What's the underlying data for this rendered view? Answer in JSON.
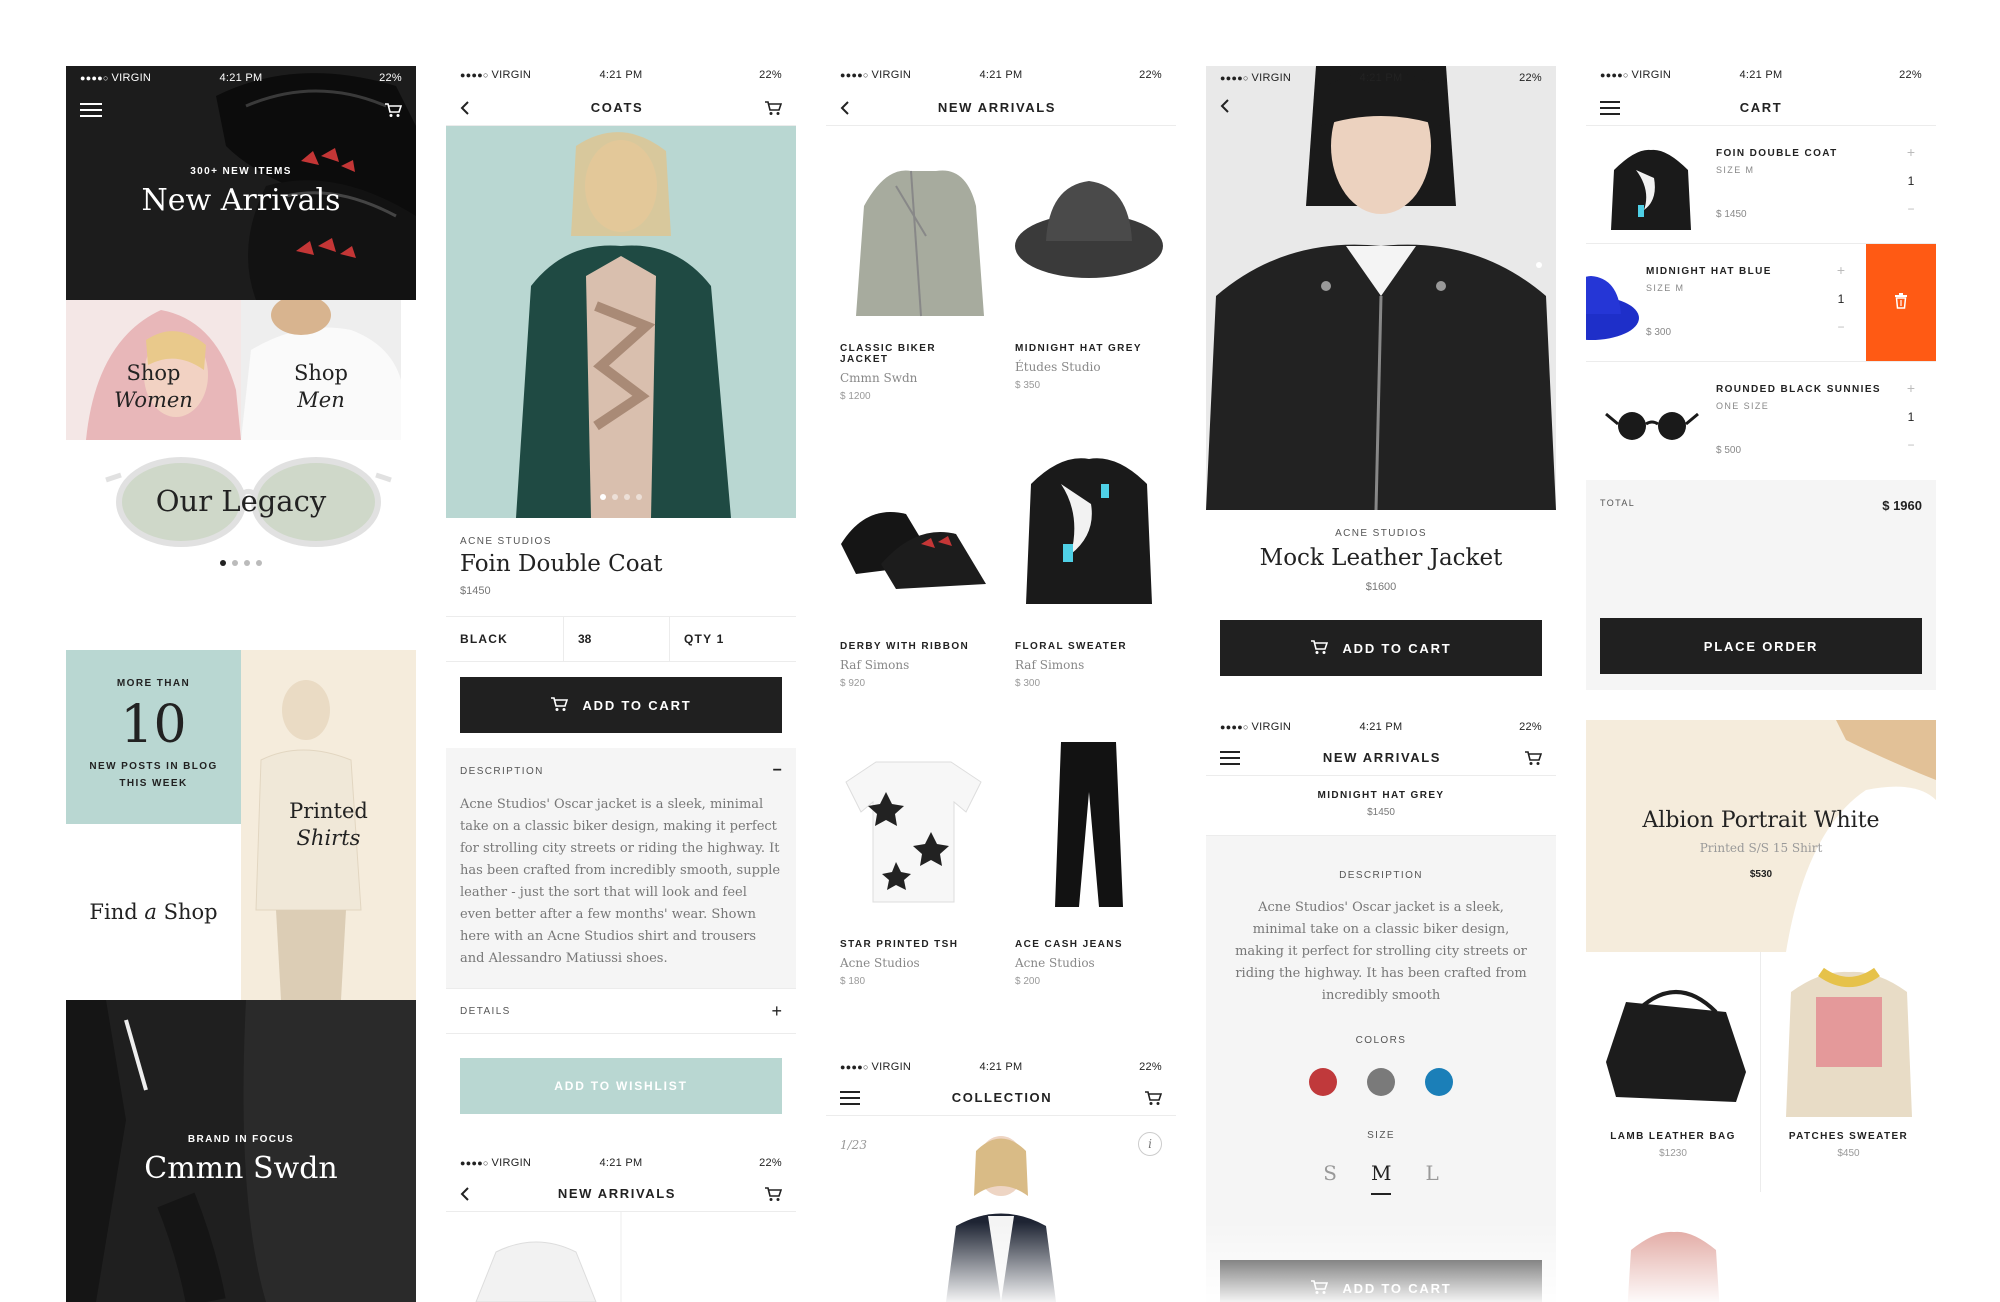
{
  "colors": {
    "accent_mint": "#b9d7d2",
    "delete_orange": "#ff5a14",
    "dark": "#202020",
    "cream": "#f5ecdc",
    "swatch_red": "#c0393b",
    "swatch_grey": "#7a7a7a",
    "swatch_blue": "#1b7fb8"
  },
  "status": {
    "carrier": "VIRGIN",
    "time": "4:21 PM",
    "battery": "22%"
  },
  "s1": {
    "hero_sub": "300+ NEW ITEMS",
    "hero_title": "New Arrivals",
    "shop_women_1": "Shop",
    "shop_women_2": "Women",
    "shop_men_1": "Shop",
    "shop_men_2": "Men",
    "legacy": "Our Legacy",
    "blog_top": "MORE THAN",
    "blog_num": "10",
    "blog_bottom_1": "NEW POSTS IN BLOG",
    "blog_bottom_2": "THIS WEEK",
    "printed_1": "Printed",
    "printed_2": "Shirts",
    "find_1": "Find",
    "find_a": "a",
    "find_2": "Shop",
    "brand_sub": "BRAND IN FOCUS",
    "brand_title": "Cmmn Swdn"
  },
  "s2": {
    "nav_title": "COATS",
    "brand": "ACNE STUDIOS",
    "title": "Foin Double Coat",
    "price": "$1450",
    "opt_color": "BLACK",
    "opt_size": "38",
    "opt_qty": "QTY 1",
    "add_to_cart": "ADD TO CART",
    "desc_label": "DESCRIPTION",
    "desc_text": "Acne Studios' Oscar jacket is a sleek, minimal take on a classic biker design, making it perfect for strolling city streets or riding the highway. It has been crafted from incredibly smooth, supple leather - just the sort that will look and feel even better after a few months' wear. Shown here with an Acne Studios shirt and trousers and Alessandro Matiussi shoes.",
    "details_label": "DETAILS",
    "wishlist": "ADD TO WISHLIST",
    "nav2_title": "NEW ARRIVALS"
  },
  "s3": {
    "nav_title": "NEW ARRIVALS",
    "products": [
      {
        "name": "CLASSIC BIKER JACKET",
        "brand": "Cmmn Swdn",
        "price": "$ 1200"
      },
      {
        "name": "MIDNIGHT HAT GREY",
        "brand": "Études Studio",
        "price": "$ 350"
      },
      {
        "name": "DERBY WITH RIBBON",
        "brand": "Raf Simons",
        "price": "$ 920"
      },
      {
        "name": "FLORAL SWEATER",
        "brand": "Raf Simons",
        "price": "$ 300"
      },
      {
        "name": "STAR PRINTED TSH",
        "brand": "Acne Studios",
        "price": "$ 180"
      },
      {
        "name": "ACE CASH JEANS",
        "brand": "Acne Studios",
        "price": "$ 200"
      }
    ],
    "nav2_title": "COLLECTION",
    "counter": "1/23",
    "info": "i"
  },
  "s4": {
    "brand": "ACNE STUDIOS",
    "title": "Mock Leather Jacket",
    "price": "$1600",
    "add_to_cart": "ADD TO CART",
    "nav2_title": "NEW ARRIVALS",
    "item_name": "MIDNIGHT HAT GREY",
    "item_price": "$1450",
    "desc_label": "DESCRIPTION",
    "desc_text": "Acne Studios' Oscar jacket is a sleek, minimal take on a classic biker design, making it perfect for strolling city streets or riding the highway. It has been crafted from incredibly smooth",
    "colors_label": "COLORS",
    "size_label": "SIZE",
    "sizes": [
      "S",
      "M",
      "L"
    ],
    "selected_size": "M",
    "add_to_cart_2": "ADD TO CART"
  },
  "s5": {
    "nav_title": "CART",
    "items": [
      {
        "name": "FOIN DOUBLE COAT",
        "size": "SIZE M",
        "price": "$ 1450",
        "qty": "1"
      },
      {
        "name": "MIDNIGHT HAT BLUE",
        "size": "SIZE M",
        "price": "$ 300",
        "qty": "1"
      },
      {
        "name": "ROUNDED BLACK SUNNIES",
        "size": "ONE SIZE",
        "price": "$ 500",
        "qty": "1"
      }
    ],
    "total_label": "TOTAL",
    "total_value": "$ 1960",
    "place_order": "PLACE ORDER",
    "promo_title": "Albion Portrait White",
    "promo_sub": "Printed S/S 15 Shirt",
    "promo_price": "$530",
    "tiles": [
      {
        "name": "LAMB LEATHER BAG",
        "price": "$1230"
      },
      {
        "name": "PATCHES SWEATER",
        "price": "$450"
      }
    ]
  }
}
